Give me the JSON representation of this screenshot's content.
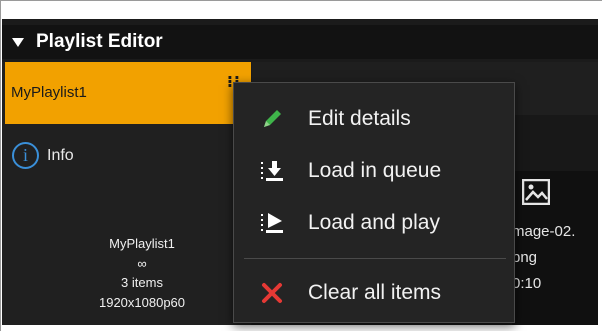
{
  "header": {
    "title": "Playlist Editor"
  },
  "playlist": {
    "selected_name": "MyPlaylist1",
    "more_glyph": "⁝⁝",
    "info_glyph": "i",
    "info_label": "Info",
    "details": {
      "name": "MyPlaylist1",
      "loop": "∞",
      "items": "3 items",
      "format": "1920x1080p60"
    }
  },
  "content": {
    "card": {
      "filename_line1": "mage-02.",
      "filename_line2": "png",
      "duration": "0:10"
    }
  },
  "context_menu": {
    "items": [
      {
        "label": "Edit details",
        "icon": "pencil-icon"
      },
      {
        "label": "Load in queue",
        "icon": "load-queue-icon"
      },
      {
        "label": "Load and play",
        "icon": "load-play-icon"
      },
      {
        "label": "Clear all items",
        "icon": "clear-x-icon"
      }
    ]
  },
  "colors": {
    "accent": "#f2a100",
    "info_blue": "#3a8fd8",
    "pencil_green": "#3fb54a",
    "clear_red": "#e53935"
  }
}
